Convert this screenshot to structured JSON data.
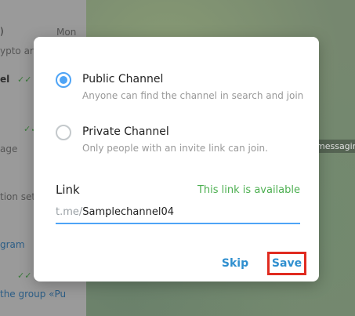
{
  "background": {
    "list_fragments": [
      {
        "text": ")",
        "cls": ""
      },
      {
        "text": "Mon",
        "cls": ""
      },
      {
        "text": "ypto ar",
        "cls": ""
      },
      {
        "text": "el",
        "cls": ""
      },
      {
        "text": "age",
        "cls": ""
      },
      {
        "text": "tion sett",
        "cls": ""
      },
      {
        "text": "gram",
        "cls": "bg-link"
      },
      {
        "text": "the group «Pu",
        "cls": "bg-link"
      }
    ],
    "chat_fragment": "messagin"
  },
  "modal": {
    "public": {
      "title": "Public Channel",
      "description": "Anyone can find the channel in search and join",
      "selected": true
    },
    "private": {
      "title": "Private Channel",
      "description": "Only people with an invite link can join.",
      "selected": false
    },
    "link": {
      "label": "Link",
      "status": "This link is available",
      "prefix": "t.me/",
      "value": "Samplechannel04"
    },
    "buttons": {
      "skip": "Skip",
      "save": "Save"
    }
  },
  "colors": {
    "accent": "#4ea4f6",
    "button_text": "#2f8fcf",
    "available": "#4caf50",
    "highlight": "#e02b20"
  }
}
